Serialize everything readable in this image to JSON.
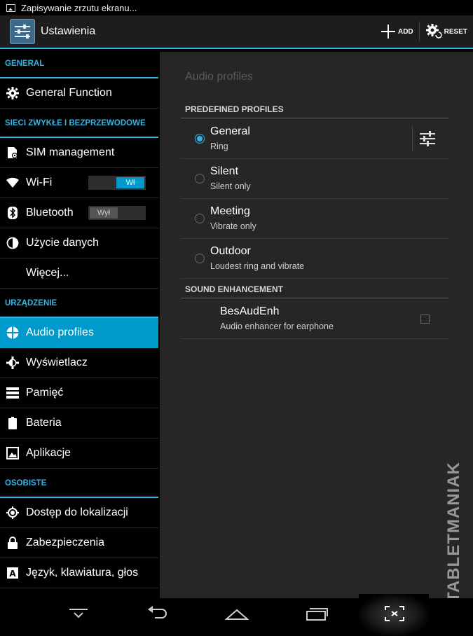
{
  "status_bar": {
    "notification": "Zapisywanie zrzutu ekranu..."
  },
  "action_bar": {
    "title": "Ustawienia",
    "add_label": "ADD",
    "reset_label": "RESET",
    "accent": "#33b5e5"
  },
  "sidebar": {
    "categories": [
      "GENERAL",
      "SIECI ZWYKŁE I BEZPRZEWODOWE",
      "URZĄDZENIE",
      "OSOBISTE"
    ],
    "items": [
      {
        "label": "General Function",
        "icon": "gear-icon"
      },
      {
        "label": "SIM management",
        "icon": "sim-card-icon"
      },
      {
        "label": "Wi-Fi",
        "icon": "wifi-icon",
        "toggle": "Wł",
        "toggle_state": "on"
      },
      {
        "label": "Bluetooth",
        "icon": "bluetooth-icon",
        "toggle": "Wył",
        "toggle_state": "off"
      },
      {
        "label": "Użycie danych",
        "icon": "data-usage-icon"
      },
      {
        "label": "Więcej...",
        "icon": ""
      },
      {
        "label": "Audio profiles",
        "icon": "audio-profiles-icon",
        "selected": true
      },
      {
        "label": "Wyświetlacz",
        "icon": "brightness-icon"
      },
      {
        "label": "Pamięć",
        "icon": "storage-icon"
      },
      {
        "label": "Bateria",
        "icon": "battery-icon"
      },
      {
        "label": "Aplikacje",
        "icon": "apps-icon"
      },
      {
        "label": "Dostęp do lokalizacji",
        "icon": "location-icon"
      },
      {
        "label": "Zabezpieczenia",
        "icon": "lock-icon"
      },
      {
        "label": "Język, klawiatura, głos",
        "icon": "keyboard-icon"
      }
    ]
  },
  "main": {
    "title": "Audio profiles",
    "predefined_header": "PREDEFINED PROFILES",
    "profiles": [
      {
        "name": "General",
        "summary": "Ring",
        "selected": true
      },
      {
        "name": "Silent",
        "summary": "Silent only",
        "selected": false
      },
      {
        "name": "Meeting",
        "summary": "Vibrate only",
        "selected": false
      },
      {
        "name": "Outdoor",
        "summary": "Loudest ring and vibrate",
        "selected": false
      }
    ],
    "enhancement_header": "SOUND ENHANCEMENT",
    "enhancement": {
      "name": "BesAudEnh",
      "summary": "Audio enhancer for earphone",
      "checked": false
    }
  },
  "watermark": "TABLETMANIAK"
}
